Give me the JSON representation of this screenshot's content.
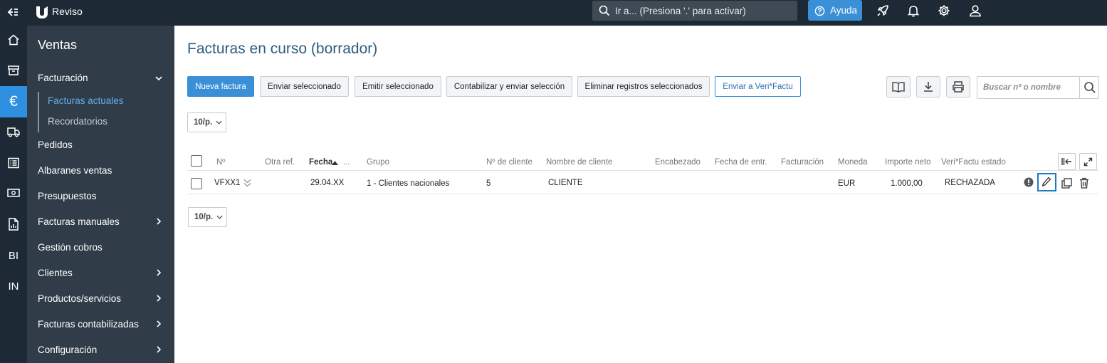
{
  "topbar": {
    "brand": "Reviso",
    "search_text": "Ir a... (Presiona '.' para activar)",
    "help_label": "Ayuda"
  },
  "iconbar": {
    "bi_label": "BI",
    "in_label": "IN"
  },
  "menu": {
    "title": "Ventas",
    "facturacion": "Facturación",
    "facturas_actuales": "Facturas actuales",
    "recordatorios": "Recordatorios",
    "pedidos": "Pedidos",
    "albaranes": "Albaranes ventas",
    "presupuestos": "Presupuestos",
    "facturas_manuales": "Facturas manuales",
    "gestion_cobros": "Gestión cobros",
    "clientes": "Clientes",
    "productos": "Productos/servicios",
    "facturas_contabilizadas": "Facturas contabilizadas",
    "configuracion": "Configuración"
  },
  "page": {
    "title": "Facturas en curso (borrador)"
  },
  "toolbar": {
    "nueva_factura": "Nueva factura",
    "enviar_seleccionado": "Enviar seleccionado",
    "emitir_seleccionado": "Emitir seleccionado",
    "contabilizar_enviar": "Contabilizar y enviar selección",
    "eliminar_registros": "Eliminar registros seleccionados",
    "enviar_verifactu": "Enviar a Veri*Factu",
    "search_placeholder": "Buscar nº o nombre"
  },
  "pager": {
    "page_size": "10/p."
  },
  "table": {
    "headers": {
      "no": "Nº",
      "otra_ref": "Otra ref.",
      "fecha": "Fecha",
      "fecha_more": "...",
      "grupo": "Grupo",
      "no_cliente": "Nº de cliente",
      "nombre_cliente": "Nombre de cliente",
      "encabezado": "Encabezado",
      "fecha_entr": "Fecha de entr.",
      "facturacion": "Facturación",
      "moneda": "Moneda",
      "importe_neto": "Importe neto",
      "verifactu_estado": "Veri*Factu estado"
    },
    "rows": [
      {
        "no": "VFXX1",
        "fecha": "29.04.XX",
        "grupo": "1 - Clientes nacionales",
        "no_cliente": "5",
        "nombre_cliente": "CLIENTE",
        "moneda": "EUR",
        "importe_neto": "1.000,00",
        "estado": "RECHAZADA"
      }
    ]
  },
  "colors": {
    "accent": "#3b8fd7",
    "topbar": "#1d2a35",
    "menu": "#303d48",
    "title": "#2f5d7c",
    "highlight": "#1c7cc3"
  }
}
